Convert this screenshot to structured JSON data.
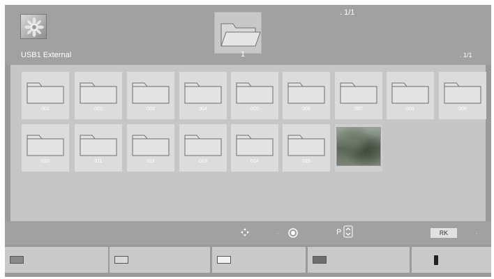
{
  "header": {
    "device_label": "USB1 External",
    "center_count": "1",
    "top_page": ". 1/1",
    "right_page": ". 1/1"
  },
  "items": [
    {
      "type": "folder",
      "label": "001"
    },
    {
      "type": "folder",
      "label": "002"
    },
    {
      "type": "folder",
      "label": "003"
    },
    {
      "type": "folder",
      "label": "004"
    },
    {
      "type": "folder",
      "label": "005"
    },
    {
      "type": "folder",
      "label": "006"
    },
    {
      "type": "folder",
      "label": "007"
    },
    {
      "type": "folder",
      "label": "008"
    },
    {
      "type": "folder",
      "label": "009"
    },
    {
      "type": "folder",
      "label": "010"
    },
    {
      "type": "folder",
      "label": "011"
    },
    {
      "type": "folder",
      "label": "012"
    },
    {
      "type": "folder",
      "label": "013"
    },
    {
      "type": "folder",
      "label": "014"
    },
    {
      "type": "folder",
      "label": "015"
    },
    {
      "type": "photo",
      "label": ""
    }
  ],
  "controls": {
    "dot_left": ".",
    "p_label": "P",
    "rk_label": "RK",
    "dot_right": "."
  },
  "buttons": [
    {
      "icon": "red-key-icon",
      "swatch_color": "#8a8a8a"
    },
    {
      "icon": "green-key-icon",
      "swatch_color": "#d9d9d9"
    },
    {
      "icon": "yellow-key-icon",
      "swatch_color": "#f2f2f2"
    },
    {
      "icon": "blue-key-icon",
      "swatch_color": "#6e6e6e"
    },
    {
      "icon": "remote-icon",
      "swatch_color": "#222222"
    }
  ],
  "colors": {
    "frame": "#9a9a9a",
    "browse_area": "#c6c6c6",
    "tile": "#dcdcdc",
    "button": "#c9c9c9"
  }
}
